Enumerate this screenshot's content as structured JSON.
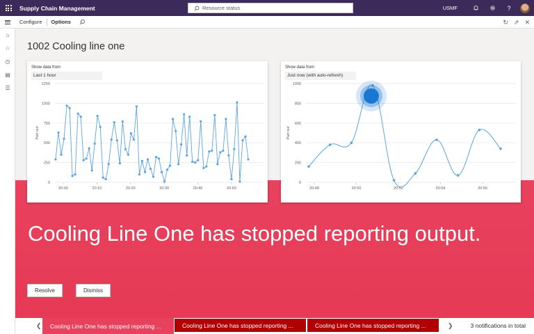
{
  "header": {
    "app_title": "Supply Chain Management",
    "search_placeholder": "Resource status",
    "company": "USMF"
  },
  "actions": {
    "configure": "Configure",
    "options": "Options"
  },
  "page": {
    "title": "1002 Cooling line one"
  },
  "chart_left": {
    "show_label": "Show data from",
    "selection": "Last 1 hour"
  },
  "chart_right": {
    "show_label": "Show data from",
    "selection": "Just now (with auto-refresh)"
  },
  "chart_data": [
    {
      "type": "line",
      "ylabel": "Part out",
      "ylim": [
        0,
        1250
      ],
      "y_ticks": [
        0,
        250,
        500,
        750,
        1000,
        1250
      ],
      "x_ticks": [
        "20:00",
        "20:10",
        "20:20",
        "20:30",
        "20:40",
        "20:50"
      ],
      "grid": true,
      "series": [
        {
          "values": [
            290,
            630,
            350,
            550,
            970,
            940,
            80,
            100,
            870,
            830,
            280,
            300,
            430,
            150,
            490,
            840,
            700,
            60,
            40,
            230,
            540,
            760,
            530,
            240,
            770,
            420,
            350,
            620,
            540,
            960,
            100,
            270,
            130,
            290,
            170,
            70,
            320,
            300,
            130,
            10,
            160,
            210,
            800,
            650,
            230,
            480,
            860,
            340,
            830,
            260,
            250,
            280,
            770,
            180,
            200,
            390,
            400,
            850,
            230,
            380,
            400,
            800,
            340,
            40,
            420,
            1010,
            10,
            530,
            580,
            290
          ]
        }
      ]
    },
    {
      "type": "line",
      "ylabel": "Part out",
      "ylim": [
        0,
        1000
      ],
      "y_ticks": [
        0,
        200,
        400,
        600,
        800,
        1000
      ],
      "x_ticks": [
        "20:48",
        "20:50",
        "20:52",
        "20:54",
        "20:56"
      ],
      "grid": true,
      "series": [
        {
          "values": [
            160,
            380,
            400,
            980,
            20,
            90,
            430,
            70,
            530,
            340
          ]
        }
      ]
    }
  ],
  "alert": {
    "message": "Cooling Line One has stopped reporting output.",
    "resolve": "Resolve",
    "dismiss": "Dismiss"
  },
  "notifications": {
    "items": [
      "Cooling Line One has stopped reporting ...",
      "Cooling Line One has stopped reporting ...",
      "Cooling Line One has stopped reporting ..."
    ],
    "total": "3 notifications in total"
  },
  "colors": {
    "topbar": "#3c2a5a",
    "alert": "#e8415e",
    "notification_dark": "#b00000",
    "series": "#5ba4e0",
    "cursor": "#1a78d4"
  }
}
